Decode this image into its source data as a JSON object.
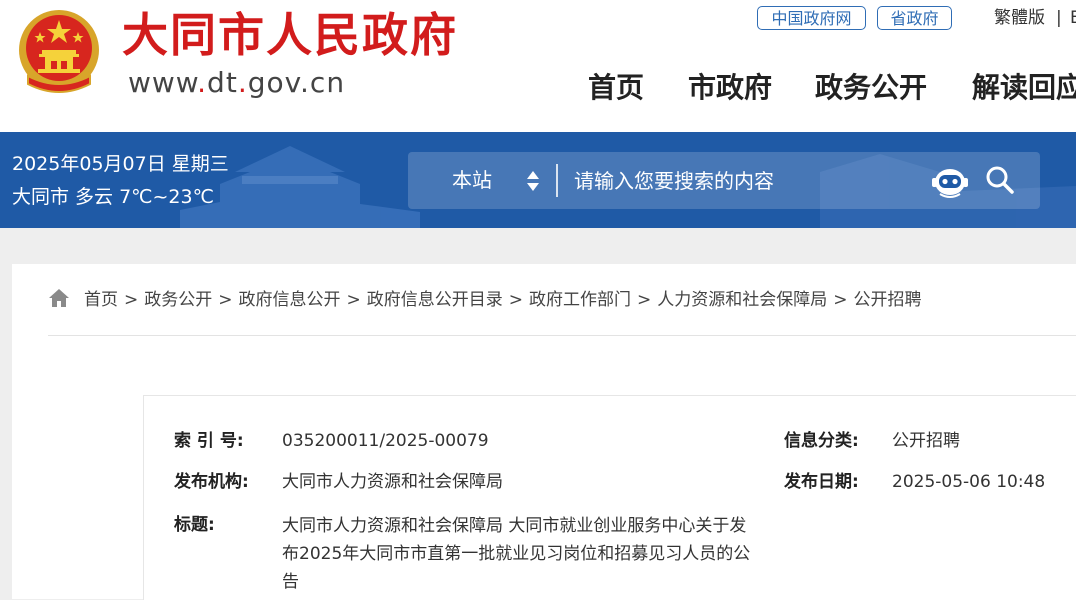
{
  "header": {
    "site_title": "大同市人民政府",
    "site_url_prefix": "www",
    "site_url_dot1": ".",
    "site_url_mid": "dt",
    "site_url_dot2": ".",
    "site_url_suffix": "gov.cn",
    "top_links": [
      "中国政府网",
      "省政府"
    ],
    "lang_label": "繁體版",
    "lang_sep": "|",
    "lang_next": "E",
    "nav": [
      "首页",
      "市政府",
      "政务公开",
      "解读回应"
    ]
  },
  "banner": {
    "date": "2025年05月07日 星期三",
    "weather": "大同市 多云 7℃~23℃",
    "search": {
      "scope": "本站",
      "placeholder": "请输入您要搜索的内容"
    }
  },
  "breadcrumb": [
    "首页",
    "政务公开",
    "政府信息公开",
    "政府信息公开目录",
    "政府工作部门",
    "人力资源和社会保障局",
    "公开招聘"
  ],
  "breadcrumb_sep": ">",
  "info": {
    "index_label": "索 引 号:",
    "index_value": "035200011/2025-00079",
    "category_label": "信息分类:",
    "category_value": "公开招聘",
    "publisher_label": "发布机构:",
    "publisher_value": "大同市人力资源和社会保障局",
    "date_label": "发布日期:",
    "date_value": "2025-05-06 10:48",
    "title_label": "标题:",
    "title_value": "大同市人力资源和社会保障局 大同市就业创业服务中心关于发布2025年大同市市直第一批就业见习岗位和招募见习人员的公告"
  },
  "colors": {
    "brand_red": "#d21c1c",
    "banner_blue": "#1f5aa6",
    "link_blue": "#2f6db5"
  },
  "icons": [
    "national-emblem",
    "up-down-arrow-icon",
    "robot-assistant-icon",
    "search-icon",
    "home-icon"
  ]
}
